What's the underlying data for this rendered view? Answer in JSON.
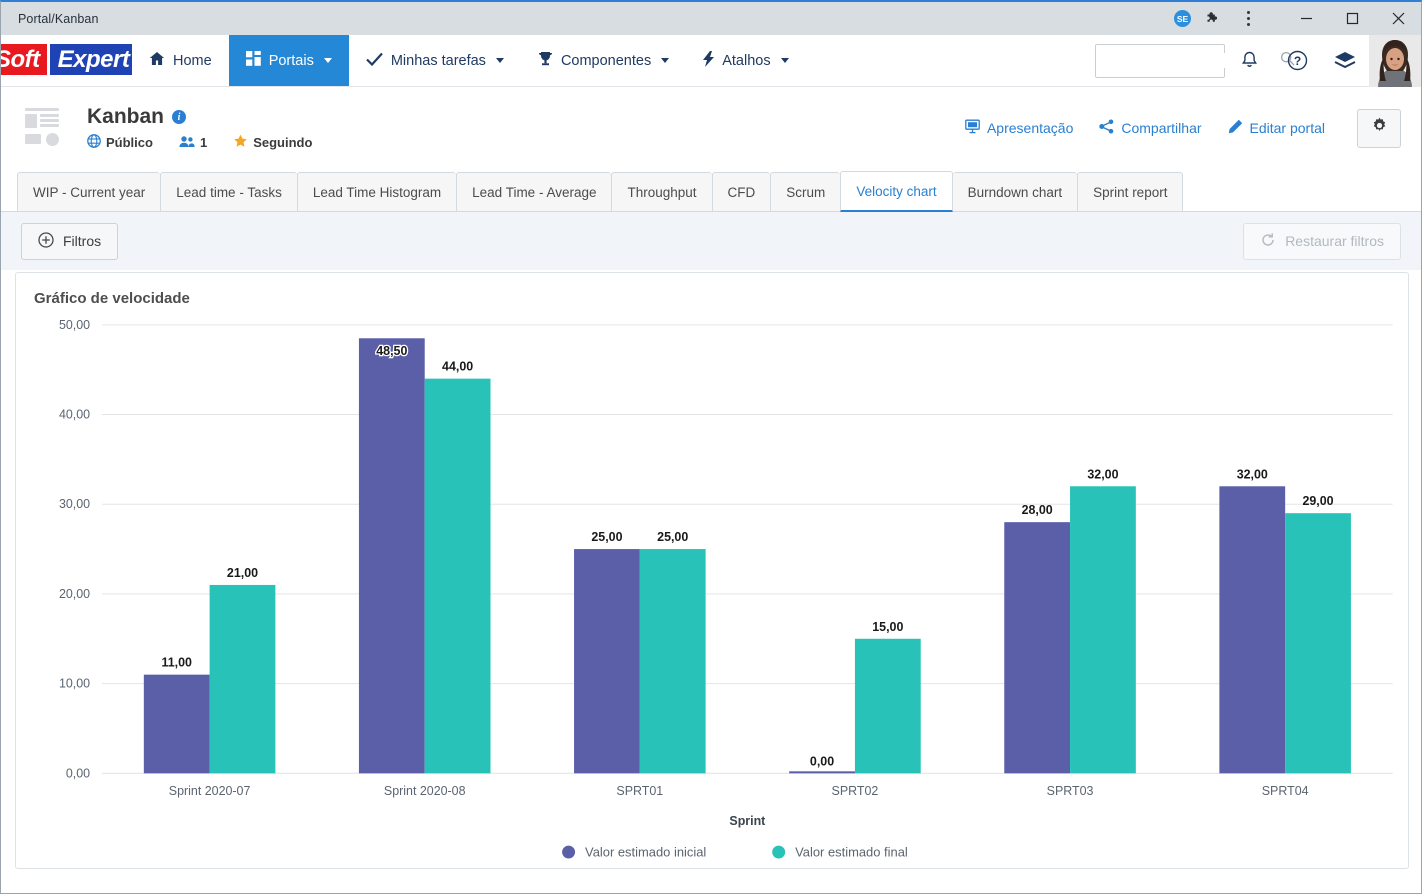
{
  "window": {
    "tab_title": "Portal/Kanban",
    "profile_badge": "SE",
    "icons": {
      "extensions": "puzzle-icon",
      "menu": "kebab-menu-icon",
      "minimize": "minimize-icon",
      "maximize": "maximize-icon",
      "close": "close-icon"
    }
  },
  "header": {
    "logo": {
      "part1": "Soft",
      "part2": "Expert"
    },
    "nav": [
      {
        "label": "Home",
        "icon": "home-icon",
        "has_caret": false,
        "active": false
      },
      {
        "label": "Portais",
        "icon": "grid-icon",
        "has_caret": true,
        "active": true
      },
      {
        "label": "Minhas tarefas",
        "icon": "check-icon",
        "has_caret": true,
        "active": false
      },
      {
        "label": "Componentes",
        "icon": "trophy-icon",
        "has_caret": true,
        "active": false
      },
      {
        "label": "Atalhos",
        "icon": "bolt-icon",
        "has_caret": true,
        "active": false
      }
    ],
    "search": {
      "value": "",
      "placeholder": "",
      "icon": "search-icon"
    },
    "actions": [
      {
        "name": "notifications",
        "icon": "bell-icon"
      },
      {
        "name": "help",
        "icon": "question-circle-icon"
      },
      {
        "name": "academy",
        "icon": "layers-icon"
      }
    ],
    "avatar": "user-avatar"
  },
  "portal": {
    "name": "Kanban",
    "info_icon": "i",
    "visibility": "Público",
    "members_count": "1",
    "follow_label": "Seguindo",
    "actions": [
      {
        "label": "Apresentação",
        "icon": "presentation-icon"
      },
      {
        "label": "Compartilhar",
        "icon": "share-icon"
      },
      {
        "label": "Editar portal",
        "icon": "pencil-icon"
      }
    ],
    "settings_icon": "gear-icon"
  },
  "tabs": [
    {
      "label": "WIP - Current year",
      "active": false
    },
    {
      "label": "Lead time - Tasks",
      "active": false
    },
    {
      "label": "Lead Time Histogram",
      "active": false
    },
    {
      "label": "Lead Time - Average",
      "active": false
    },
    {
      "label": "Throughput",
      "active": false
    },
    {
      "label": "CFD",
      "active": false
    },
    {
      "label": "Scrum",
      "active": false
    },
    {
      "label": "Velocity chart",
      "active": true
    },
    {
      "label": "Burndown chart",
      "active": false
    },
    {
      "label": "Sprint report",
      "active": false
    }
  ],
  "filterbar": {
    "filters_label": "Filtros",
    "filters_icon": "plus-circle-icon",
    "restore_label": "Restaurar filtros",
    "restore_icon": "refresh-icon",
    "restore_disabled": true
  },
  "card": {
    "title": "Gráfico de velocidade"
  },
  "chart_data": {
    "type": "bar",
    "title": "Gráfico de velocidade",
    "xlabel": "Sprint",
    "ylabel": "",
    "ylim": [
      0,
      50
    ],
    "yticks": [
      "0,00",
      "10,00",
      "20,00",
      "30,00",
      "40,00",
      "50,00"
    ],
    "ytick_values": [
      0,
      10,
      20,
      30,
      40,
      50
    ],
    "grid": true,
    "legend_position": "bottom",
    "categories": [
      "Sprint 2020-07",
      "Sprint 2020-08",
      "SPRT01",
      "SPRT02",
      "SPRT03",
      "SPRT04"
    ],
    "series": [
      {
        "name": "Valor estimado inicial",
        "color": "#5b5fa8",
        "values": [
          11,
          48.5,
          25,
          0,
          28,
          32
        ],
        "labels": [
          "11,00",
          "48,50",
          "25,00",
          "0,00",
          "28,00",
          "32,00"
        ]
      },
      {
        "name": "Valor estimado final",
        "color": "#28c2b8",
        "values": [
          21,
          44,
          25,
          15,
          32,
          29
        ],
        "labels": [
          "21,00",
          "44,00",
          "25,00",
          "15,00",
          "32,00",
          "29,00"
        ]
      }
    ]
  },
  "colors": {
    "accent_blue": "#2a7fd0",
    "nav_active": "#2488d6",
    "series_initial": "#5b5fa8",
    "series_final": "#28c2b8",
    "logo_red": "#e8191f",
    "logo_blue": "#1f43b5"
  }
}
